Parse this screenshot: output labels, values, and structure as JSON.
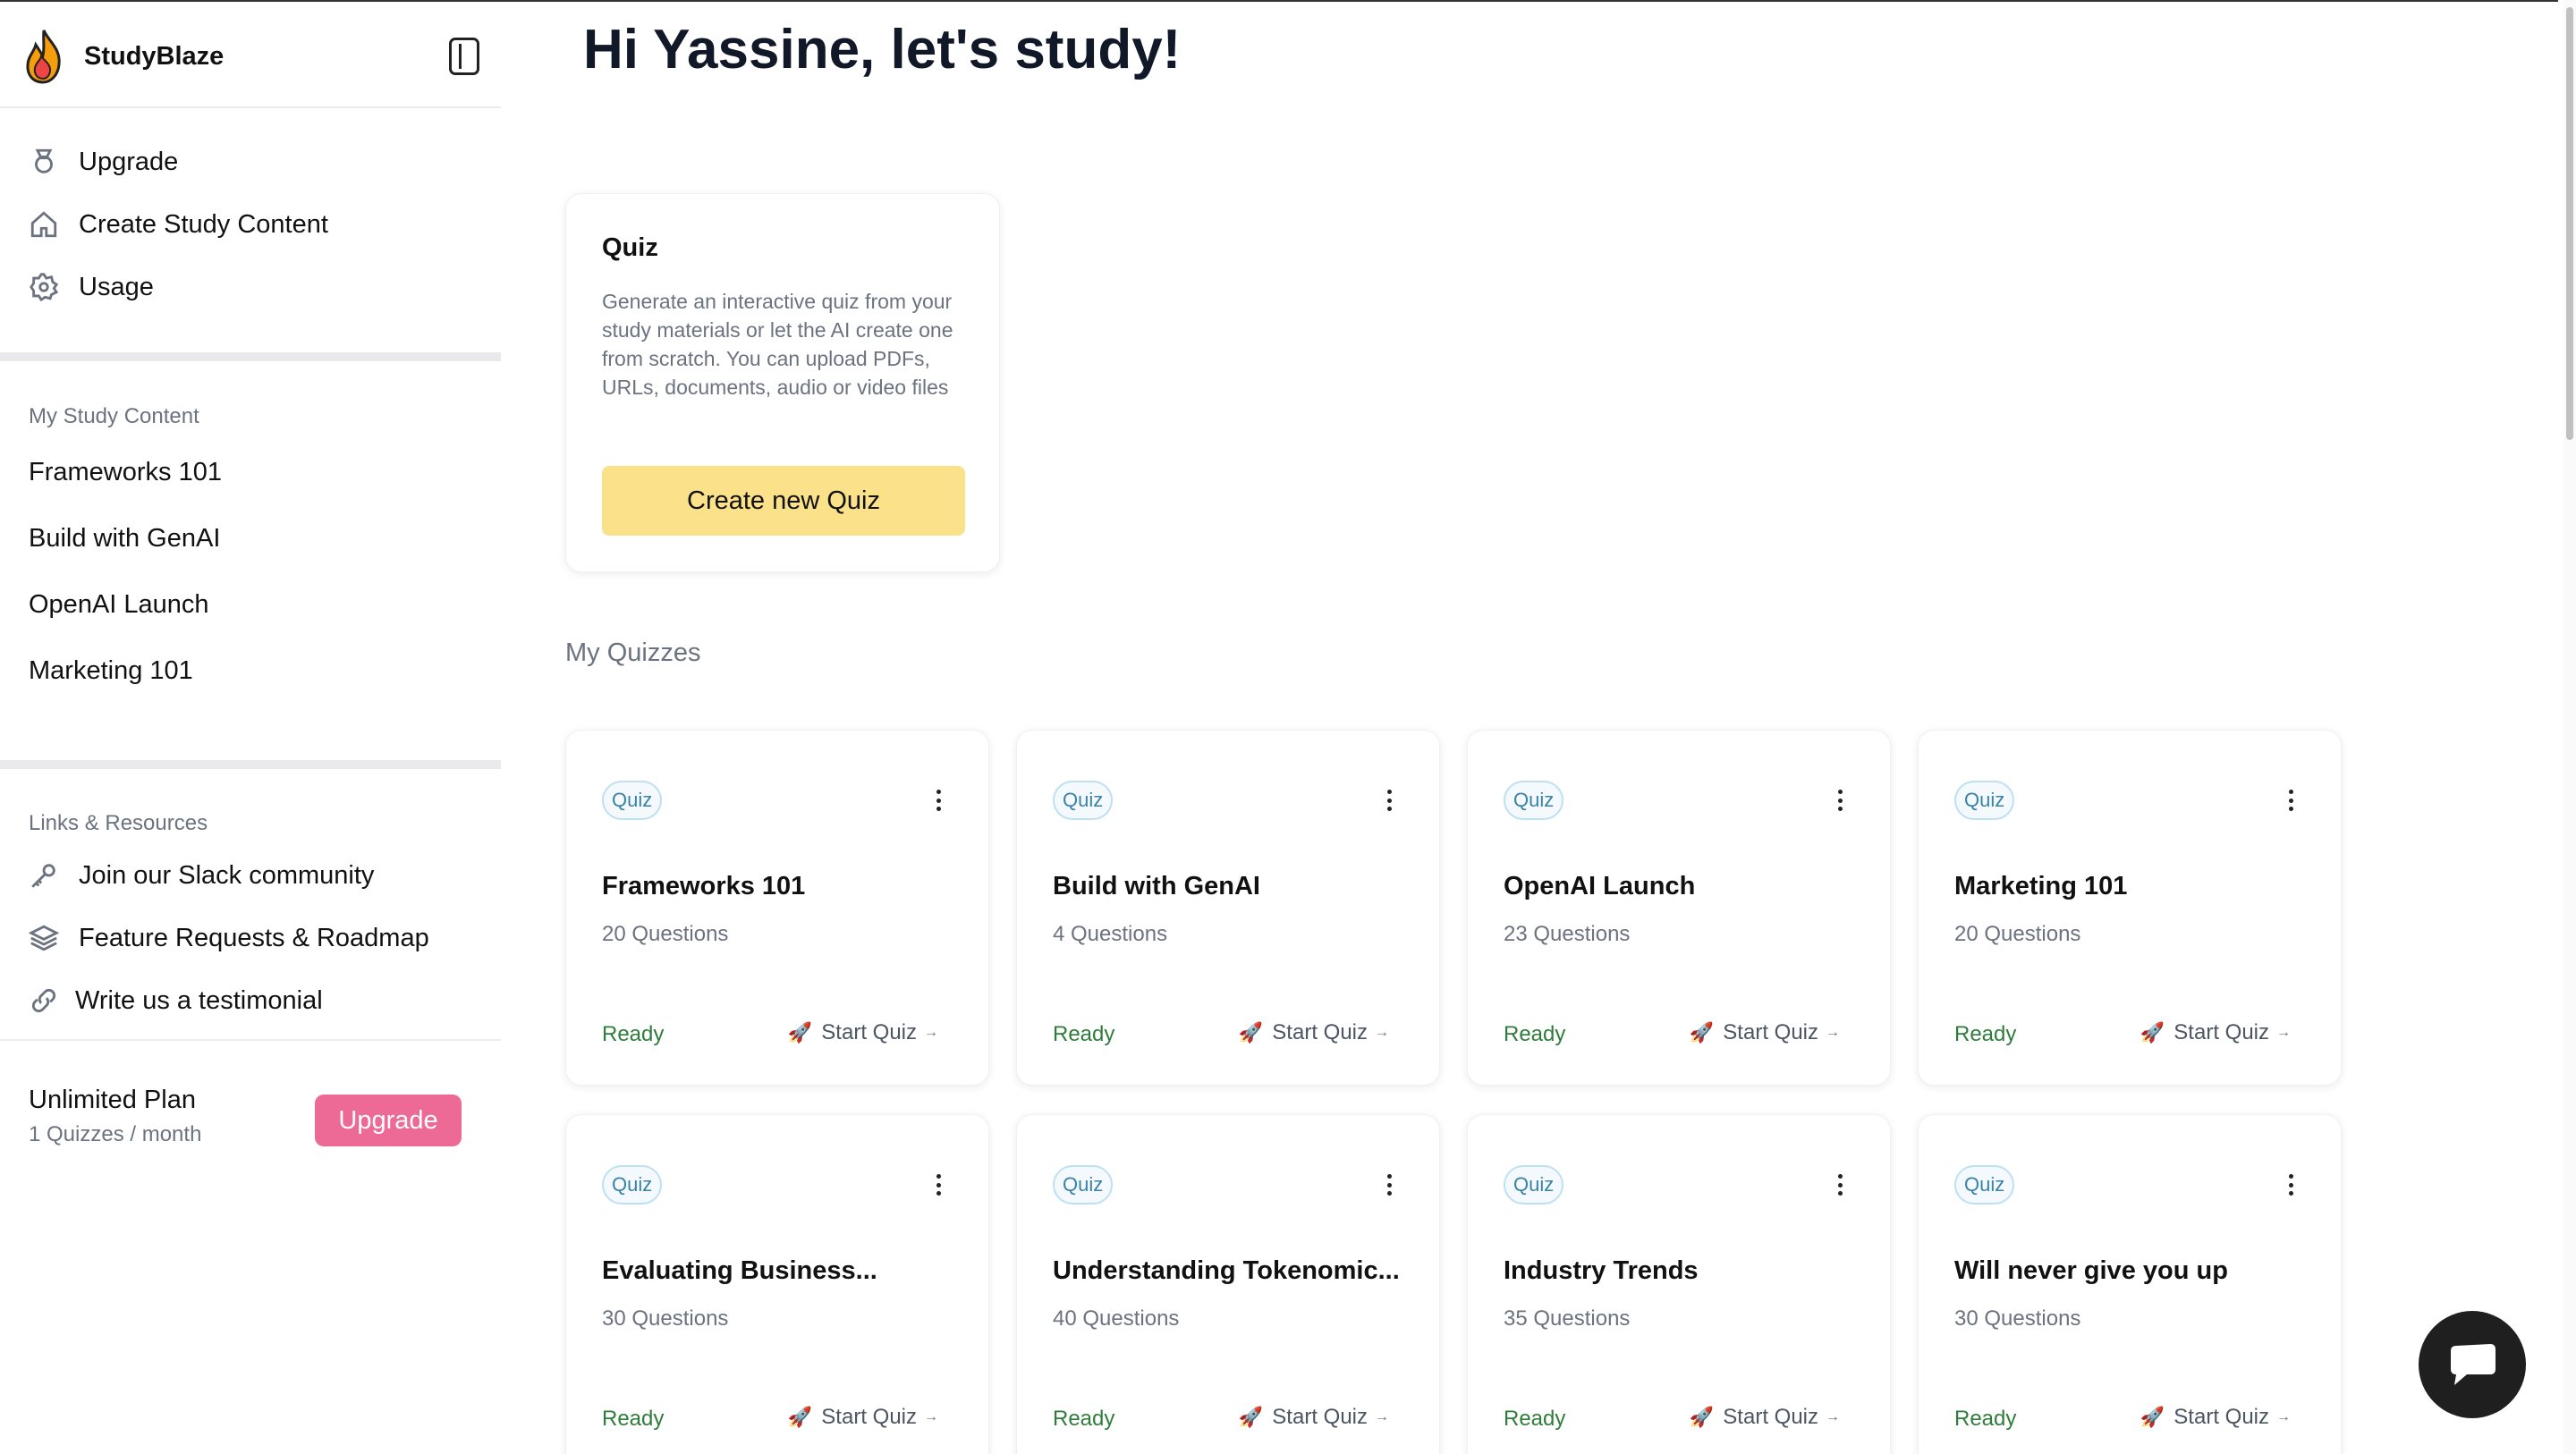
{
  "sidebar": {
    "brand": "StudyBlaze",
    "nav": [
      {
        "label": "Upgrade",
        "icon": "badge-icon"
      },
      {
        "label": "Create Study Content",
        "icon": "home-icon"
      },
      {
        "label": "Usage",
        "icon": "gear-icon"
      }
    ],
    "my_content_label": "My Study Content",
    "my_content": [
      "Frameworks 101",
      "Build with GenAI",
      "OpenAI Launch",
      "Marketing 101"
    ],
    "links_label": "Links & Resources",
    "links": [
      {
        "label": "Join our Slack community",
        "icon": "key-icon"
      },
      {
        "label": "Feature Requests & Roadmap",
        "icon": "layers-icon"
      },
      {
        "label": "Write us a testimonial",
        "icon": "link-icon"
      }
    ],
    "plan": {
      "title": "Unlimited Plan",
      "sub": "1 Quizzes / month",
      "upgrade": "Upgrade"
    }
  },
  "main": {
    "greeting": "Hi Yassine, let's study!",
    "create_card": {
      "title": "Quiz",
      "description": "Generate an interactive quiz from your study materials or let the AI create one from scratch. You can upload PDFs, URLs, documents, audio or video files",
      "button": "Create new Quiz"
    },
    "section_title": "My Quizzes",
    "quizzes": [
      {
        "badge": "Quiz",
        "title": "Frameworks 101",
        "count": "20 Questions",
        "status": "Ready",
        "action": "Start Quiz"
      },
      {
        "badge": "Quiz",
        "title": "Build with GenAI",
        "count": "4 Questions",
        "status": "Ready",
        "action": "Start Quiz"
      },
      {
        "badge": "Quiz",
        "title": "OpenAI Launch",
        "count": "23 Questions",
        "status": "Ready",
        "action": "Start Quiz"
      },
      {
        "badge": "Quiz",
        "title": "Marketing 101",
        "count": "20 Questions",
        "status": "Ready",
        "action": "Start Quiz"
      },
      {
        "badge": "Quiz",
        "title": "Evaluating Business...",
        "count": "30 Questions",
        "status": "Ready",
        "action": "Start Quiz"
      },
      {
        "badge": "Quiz",
        "title": "Understanding Tokenomic...",
        "count": "40 Questions",
        "status": "Ready",
        "action": "Start Quiz"
      },
      {
        "badge": "Quiz",
        "title": "Industry Trends",
        "count": "35 Questions",
        "status": "Ready",
        "action": "Start Quiz"
      },
      {
        "badge": "Quiz",
        "title": "Will never give you up",
        "count": "30 Questions",
        "status": "Ready",
        "action": "Start Quiz"
      }
    ]
  },
  "colors": {
    "accent_yellow": "#fae18a",
    "upgrade_pink": "#ec6a95",
    "ready_green": "#2f7d3a",
    "badge_blue": "#3b82a6"
  }
}
